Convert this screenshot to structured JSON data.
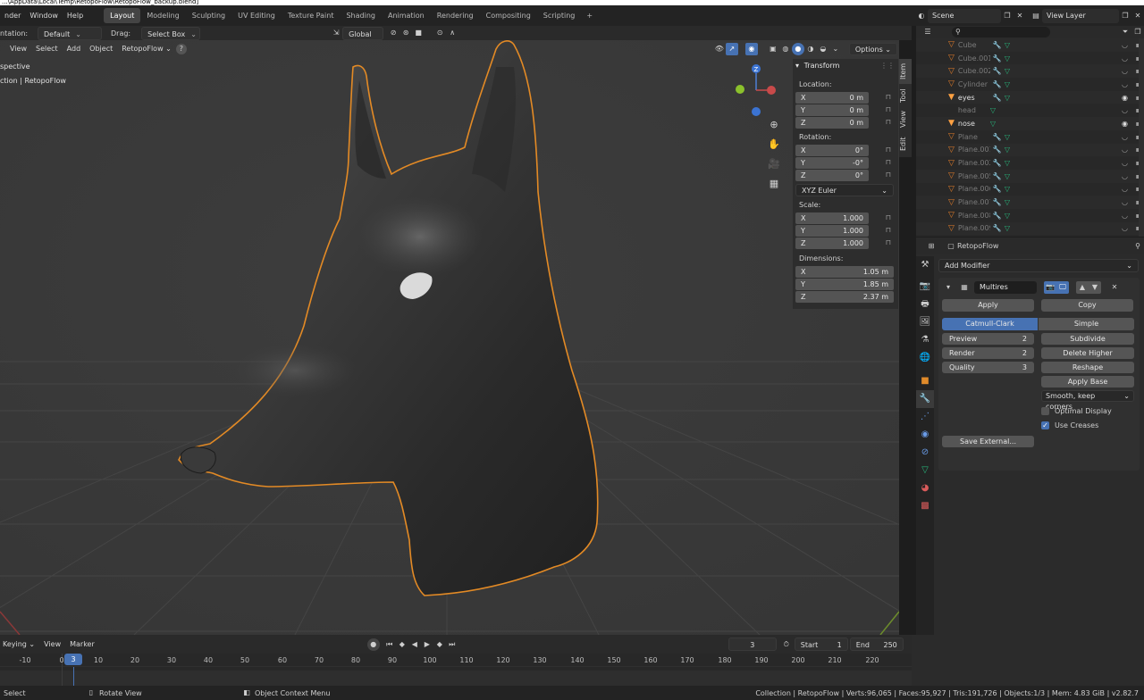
{
  "titlebar": {
    "text": "...\\AppData\\Local\\Temp\\RetopoFlow\\RetopoFlow_backup.blend]"
  },
  "menubar": {
    "items": [
      "nder",
      "Window",
      "Help"
    ]
  },
  "workspaces": [
    "Layout",
    "Modeling",
    "Sculpting",
    "UV Editing",
    "Texture Paint",
    "Shading",
    "Animation",
    "Rendering",
    "Compositing",
    "Scripting"
  ],
  "workspace_add": "+",
  "scene": {
    "label": "Scene",
    "view_layer": "View Layer"
  },
  "toolheader": {
    "orientation_label": "ntation:",
    "orientation_value": "Default",
    "drag_label": "Drag:",
    "drag_value": "Select Box",
    "transform_value": "Global"
  },
  "viewport_header": {
    "view": "View",
    "select": "Select",
    "add": "Add",
    "object": "Object",
    "mode": "RetopoFlow",
    "options": "Options"
  },
  "viewport_overlay": {
    "perspective": "spective",
    "collection": "ction | RetopoFlow"
  },
  "gizmo": {
    "z": "Z",
    "y": "Y"
  },
  "transform_panel": {
    "title": "Transform",
    "location_label": "Location:",
    "location": [
      {
        "axis": "X",
        "value": "0 m"
      },
      {
        "axis": "Y",
        "value": "0 m"
      },
      {
        "axis": "Z",
        "value": "0 m"
      }
    ],
    "rotation_label": "Rotation:",
    "rotation": [
      {
        "axis": "X",
        "value": "0°"
      },
      {
        "axis": "Y",
        "value": "-0°"
      },
      {
        "axis": "Z",
        "value": "0°"
      }
    ],
    "rotation_mode": "XYZ Euler",
    "scale_label": "Scale:",
    "scale": [
      {
        "axis": "X",
        "value": "1.000"
      },
      {
        "axis": "Y",
        "value": "1.000"
      },
      {
        "axis": "Z",
        "value": "1.000"
      }
    ],
    "dimensions_label": "Dimensions:",
    "dimensions": [
      {
        "axis": "X",
        "value": "1.05 m"
      },
      {
        "axis": "Y",
        "value": "1.85 m"
      },
      {
        "axis": "Z",
        "value": "2.37 m"
      }
    ]
  },
  "side_tabs": [
    "Item",
    "Tool",
    "View",
    "Edit"
  ],
  "outliner": {
    "search_placeholder": "",
    "rows": [
      {
        "name": "Cube",
        "visible": false
      },
      {
        "name": "Cube.001",
        "visible": false
      },
      {
        "name": "Cube.002",
        "visible": false
      },
      {
        "name": "Cylinder",
        "visible": false
      },
      {
        "name": "eyes",
        "visible": true
      },
      {
        "name": "head",
        "visible": false
      },
      {
        "name": "nose",
        "visible": true
      },
      {
        "name": "Plane",
        "visible": false
      },
      {
        "name": "Plane.001",
        "visible": false
      },
      {
        "name": "Plane.002",
        "visible": false
      },
      {
        "name": "Plane.005",
        "visible": false
      },
      {
        "name": "Plane.006",
        "visible": false
      },
      {
        "name": "Plane.007",
        "visible": false
      },
      {
        "name": "Plane.008",
        "visible": false
      },
      {
        "name": "Plane.009",
        "visible": false
      }
    ]
  },
  "properties": {
    "object_name": "RetopoFlow",
    "add_modifier": "Add Modifier",
    "modifier_name": "Multires",
    "apply": "Apply",
    "copy": "Copy",
    "catmull": "Catmull-Clark",
    "simple": "Simple",
    "preview_label": "Preview",
    "preview_value": "2",
    "render_label": "Render",
    "render_value": "2",
    "quality_label": "Quality",
    "quality_value": "3",
    "subdivide": "Subdivide",
    "delete_higher": "Delete Higher",
    "reshape": "Reshape",
    "apply_base": "Apply Base",
    "uv_smooth": "Smooth, keep corners",
    "optimal_display": "Optimal Display",
    "use_creases": "Use Creases",
    "save_external": "Save External..."
  },
  "timeline": {
    "keying": "Keying",
    "view": "View",
    "marker": "Marker",
    "current_frame": "3",
    "start_label": "Start",
    "start_value": "1",
    "end_label": "End",
    "end_value": "250",
    "ticks": [
      "-10",
      "0",
      "10",
      "20",
      "30",
      "40",
      "50",
      "60",
      "70",
      "80",
      "90",
      "100",
      "110",
      "120",
      "130",
      "140",
      "150",
      "160",
      "170",
      "180",
      "190",
      "200",
      "210",
      "220"
    ]
  },
  "statusbar": {
    "select": "Select",
    "rotate": "Rotate View",
    "context": "Object Context Menu",
    "stats": "Collection | RetopoFlow | Verts:96,065 | Faces:95,927 | Tris:191,726 | Objects:1/3 | Mem: 4.83 GiB | v2.82.7"
  }
}
